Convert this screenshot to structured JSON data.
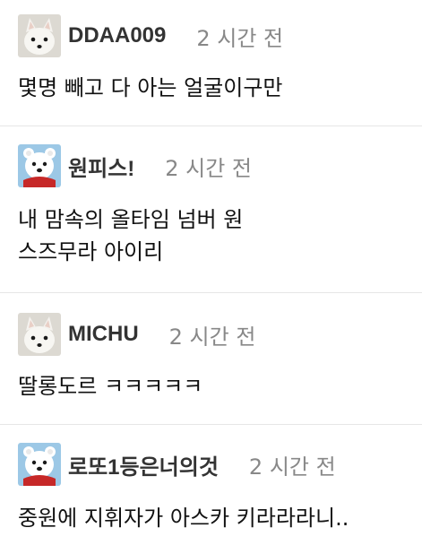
{
  "comments": [
    {
      "nickname": "DDAA009",
      "time": "2 시간 전",
      "text_lines": [
        "몇명 빼고 다 아는 얼굴이구만"
      ],
      "avatar": "arctic-fox"
    },
    {
      "nickname": "원피스!",
      "time": "2 시간 전",
      "text_lines": [
        "내 맘속의 올타임 넘버 원",
        "스즈무라 아이리"
      ],
      "avatar": "polar-bear"
    },
    {
      "nickname": "MICHU",
      "time": "2 시간 전",
      "text_lines": [
        "딸롱도르 ㅋㅋㅋㅋㅋ"
      ],
      "avatar": "arctic-fox"
    },
    {
      "nickname": "로또1등은너의것",
      "time": "2 시간 전",
      "text_lines": [
        "중원에 지휘자가 아스카 키라라라니.."
      ],
      "avatar": "polar-bear"
    }
  ],
  "colors": {
    "nickname": "#333333",
    "time": "#888888",
    "divider": "#e6e6e6"
  }
}
